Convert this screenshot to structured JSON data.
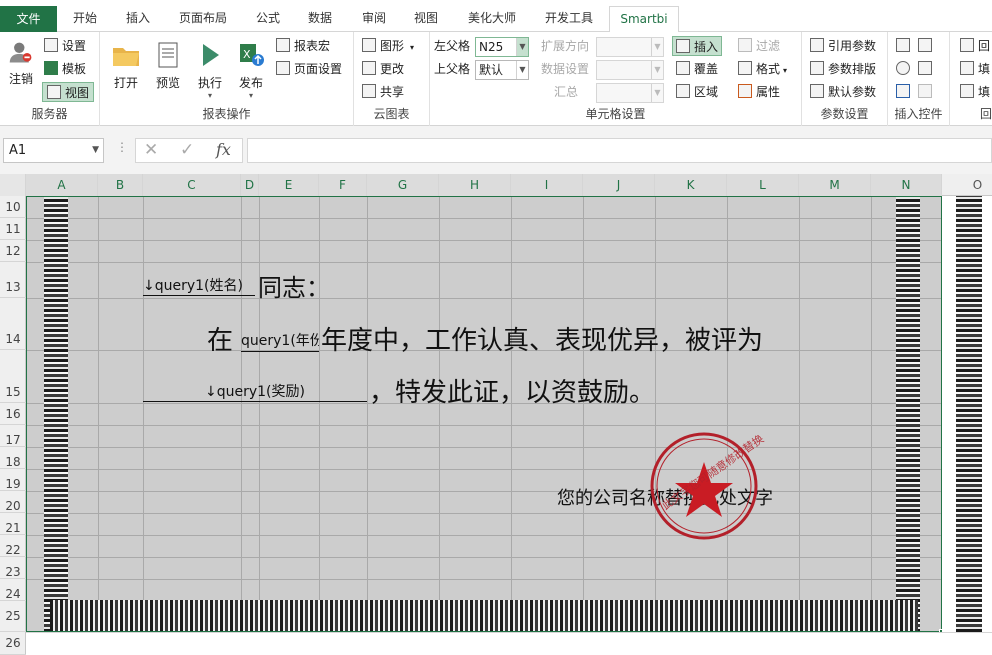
{
  "tabs": [
    "文件",
    "开始",
    "插入",
    "页面布局",
    "公式",
    "数据",
    "审阅",
    "视图",
    "美化大师",
    "开发工具",
    "Smartbi"
  ],
  "ribbon": {
    "server": {
      "label": "服务器",
      "login": "注销",
      "settings": "设置",
      "template": "模板",
      "view": "视图"
    },
    "report": {
      "label": "报表操作",
      "open": "打开",
      "preview": "预览",
      "execute": "执行",
      "publish": "发布",
      "macro": "报表宏",
      "page_setup": "页面设置"
    },
    "cloud": {
      "label": "云图表",
      "chart": "图形",
      "change": "更改",
      "share": "共享"
    },
    "cell": {
      "label": "单元格设置",
      "left_parent": "左父格",
      "left_parent_value": "N25",
      "top_parent": "上父格",
      "top_parent_value": "默认",
      "expand_dir": "扩展方向",
      "data_setting": "数据设置",
      "summary": "汇总",
      "insert": "插入",
      "overwrite": "覆盖",
      "region": "区域",
      "filter": "过滤",
      "format": "格式",
      "property": "属性"
    },
    "params": {
      "label": "参数设置",
      "ref": "引用参数",
      "layout": "参数排版",
      "default": "默认参数"
    },
    "controls": {
      "label": "插入控件"
    },
    "extra": {
      "label": "回",
      "item1": "回",
      "item2": "填",
      "item3": "填"
    }
  },
  "formula_bar": {
    "name_box": "A1",
    "fx": "fx",
    "cancel": "✕",
    "confirm": "✓",
    "value": ""
  },
  "columns": [
    "A",
    "B",
    "C",
    "D",
    "E",
    "F",
    "G",
    "H",
    "I",
    "J",
    "K",
    "L",
    "M",
    "N",
    "O"
  ],
  "rows": [
    "10",
    "11",
    "12",
    "13",
    "14",
    "15",
    "16",
    "17",
    "18",
    "19",
    "20",
    "21",
    "22",
    "23",
    "24",
    "25",
    "26"
  ],
  "certificate": {
    "name_field": "↓query1(姓名)",
    "greeting": "同志：",
    "zai": "在",
    "year_field": "query1(年份",
    "line1": "年度中，工作认真、表现优异，被评为",
    "award_field": "↓query1(奖励)",
    "line2": "，特发此证，以资鼓励。",
    "company": "您的公司名称替换此处文字",
    "seal_text": "此文字您可随意修改替换"
  }
}
